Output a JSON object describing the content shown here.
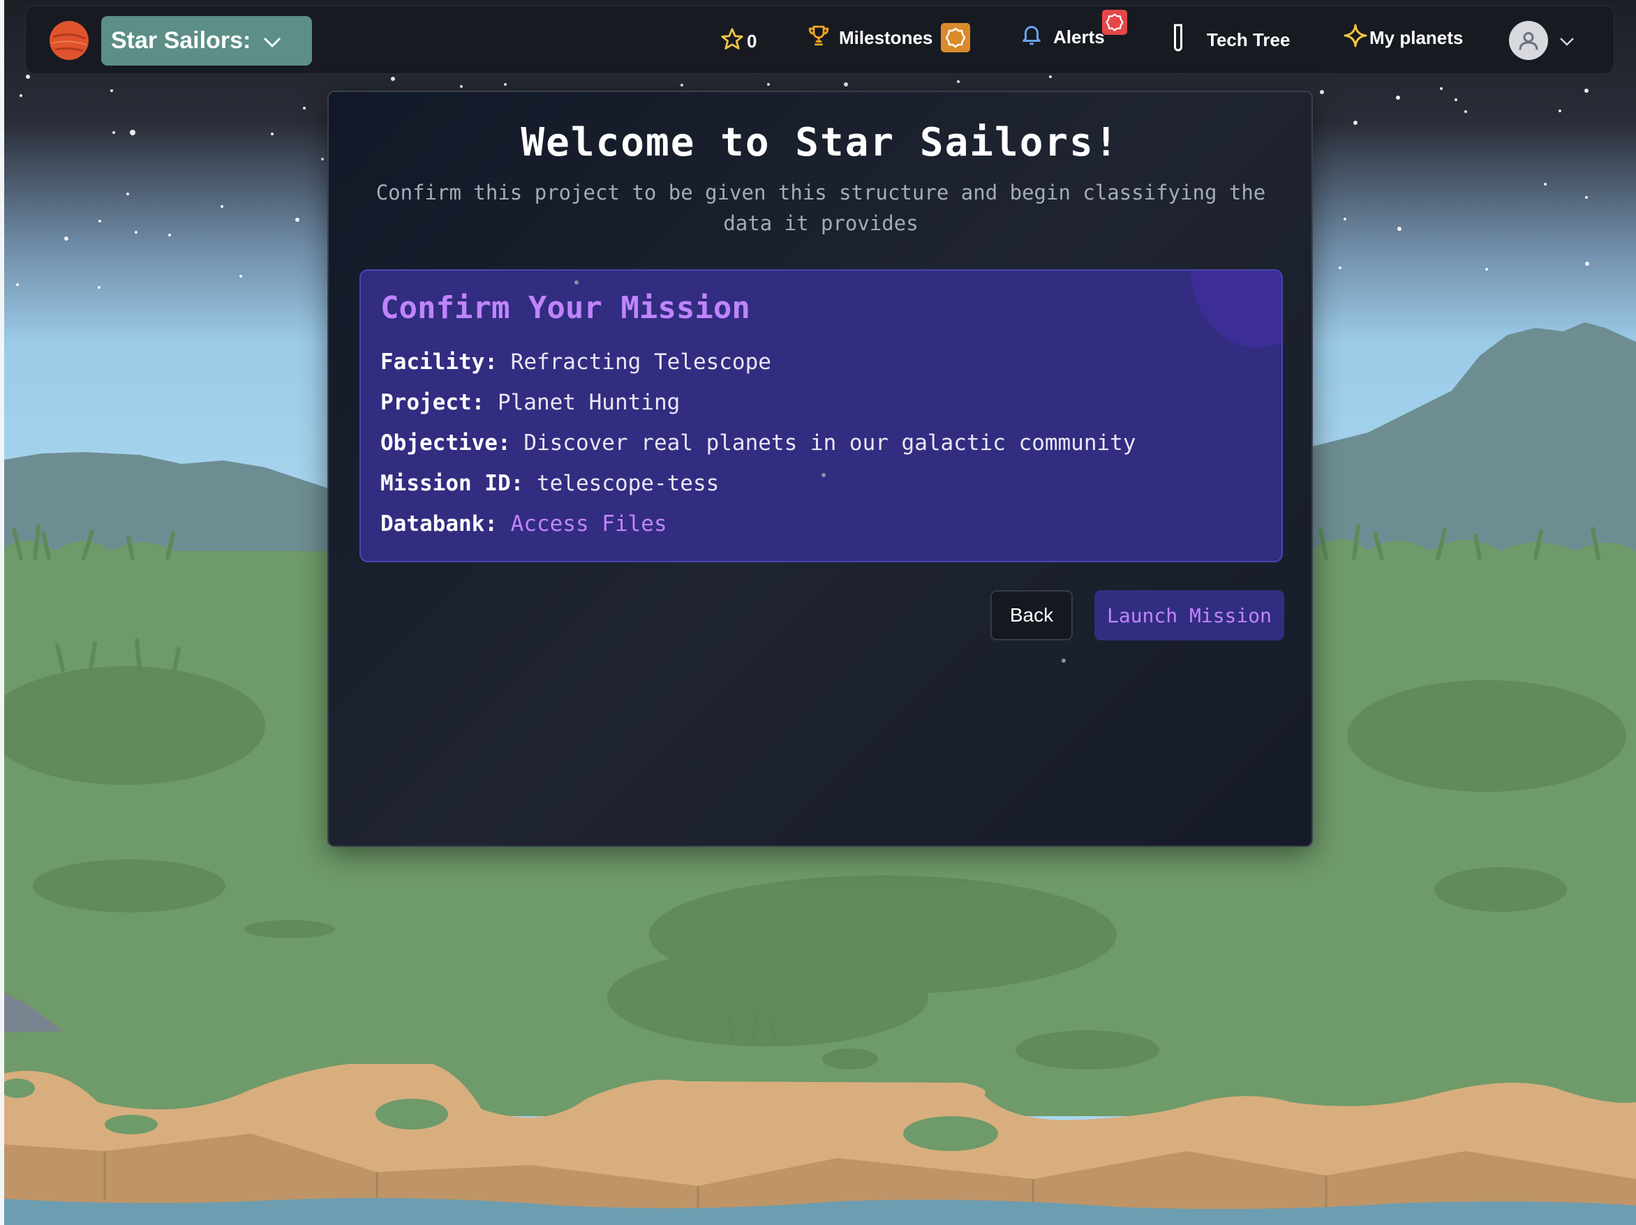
{
  "navbar": {
    "brand_label": "Star Sailors:",
    "stars_count": "0",
    "milestones_label": "Milestones",
    "alerts_label": "Alerts",
    "techtree_label": "Tech Tree",
    "myplanets_label": "My planets"
  },
  "modal": {
    "title": "Welcome to Star Sailors!",
    "subtitle": "Confirm this project to be given this structure and begin classifying the data it provides",
    "card": {
      "title": "Confirm Your Mission",
      "fields": [
        {
          "label": "Facility:",
          "value": "Refracting Telescope"
        },
        {
          "label": "Project:",
          "value": "Planet Hunting"
        },
        {
          "label": "Objective:",
          "value": "Discover real planets in our galactic community"
        },
        {
          "label": "Mission ID:",
          "value": "telescope-tess"
        },
        {
          "label": "Databank:",
          "value": "Access Files"
        }
      ]
    },
    "back_label": "Back",
    "launch_label": "Launch Mission"
  },
  "colors": {
    "accent_purple": "#c084fc",
    "card_bg": "#322d80",
    "brand_button": "#5d8e88",
    "alert_badge": "#e54848",
    "milestone_badge": "#d98a2b",
    "grass": "#6f9a69",
    "sky_top": "#1d1f27",
    "sky_bottom": "#a5d4ee"
  },
  "icons": [
    "planet-logo-icon",
    "chevron-down-icon",
    "star-icon",
    "trophy-icon",
    "bell-icon",
    "test-tube-icon",
    "sparkle-icon",
    "user-icon"
  ]
}
